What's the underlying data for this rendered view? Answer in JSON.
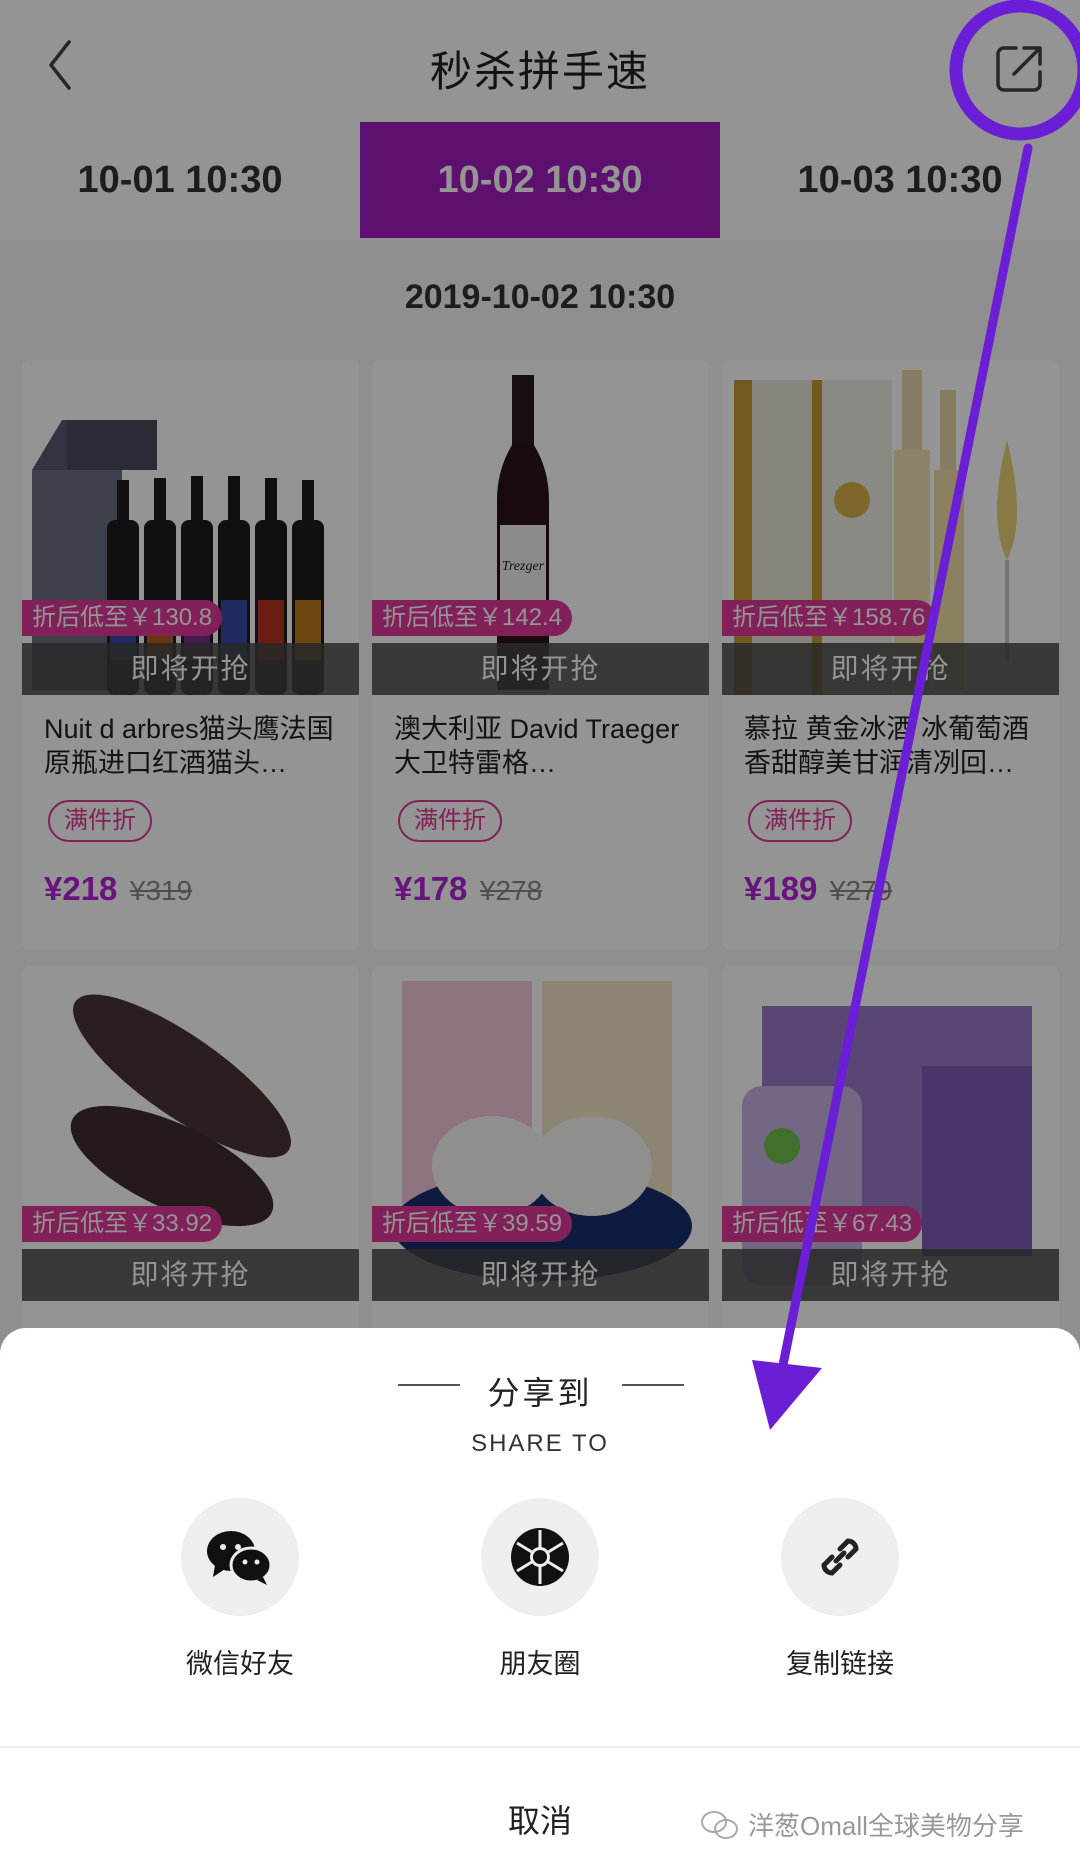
{
  "header": {
    "title": "秒杀拼手速",
    "back_icon": "chevron-left-icon",
    "share_icon": "share-out-icon"
  },
  "tabs": [
    {
      "label": "10-01 10:30",
      "active": false
    },
    {
      "label": "10-02 10:30",
      "active": true
    },
    {
      "label": "10-03 10:30",
      "active": false
    }
  ],
  "date_line": "2019-10-02 10:30",
  "products": [
    {
      "tag": "折后低至￥130.8",
      "status": "即将开抢",
      "name": "Nuit d arbres猫头鹰法国原瓶进口红酒猫头…",
      "badge": "满件折",
      "price": "¥218",
      "old_price": "¥319"
    },
    {
      "tag": "折后低至￥142.4",
      "status": "即将开抢",
      "name": "澳大利亚 David Traeger大卫特雷格…",
      "badge": "满件折",
      "price": "¥178",
      "old_price": "¥278"
    },
    {
      "tag": "折后低至￥158.76",
      "status": "即将开抢",
      "name": "慕拉 黄金冰酒 冰葡萄酒香甜醇美甘润清冽回…",
      "badge": "满件折",
      "price": "¥189",
      "old_price": "¥279"
    },
    {
      "tag": "折后低至￥33.92",
      "status": "即将开抢"
    },
    {
      "tag": "折后低至￥39.59",
      "status": "即将开抢"
    },
    {
      "tag": "折后低至￥67.43",
      "status": "即将开抢"
    }
  ],
  "sheet": {
    "title": "分享到",
    "subtitle": "SHARE TO",
    "options": [
      {
        "label": "微信好友",
        "icon": "wechat-icon"
      },
      {
        "label": "朋友圈",
        "icon": "moments-icon"
      },
      {
        "label": "复制链接",
        "icon": "link-icon"
      }
    ],
    "cancel": "取消"
  },
  "watermark": "洋葱Omall全球美物分享",
  "colors": {
    "accent": "#a21cc1",
    "price": "#b424d6",
    "tag": "#e0399a",
    "annotation": "#6a1fd6"
  }
}
